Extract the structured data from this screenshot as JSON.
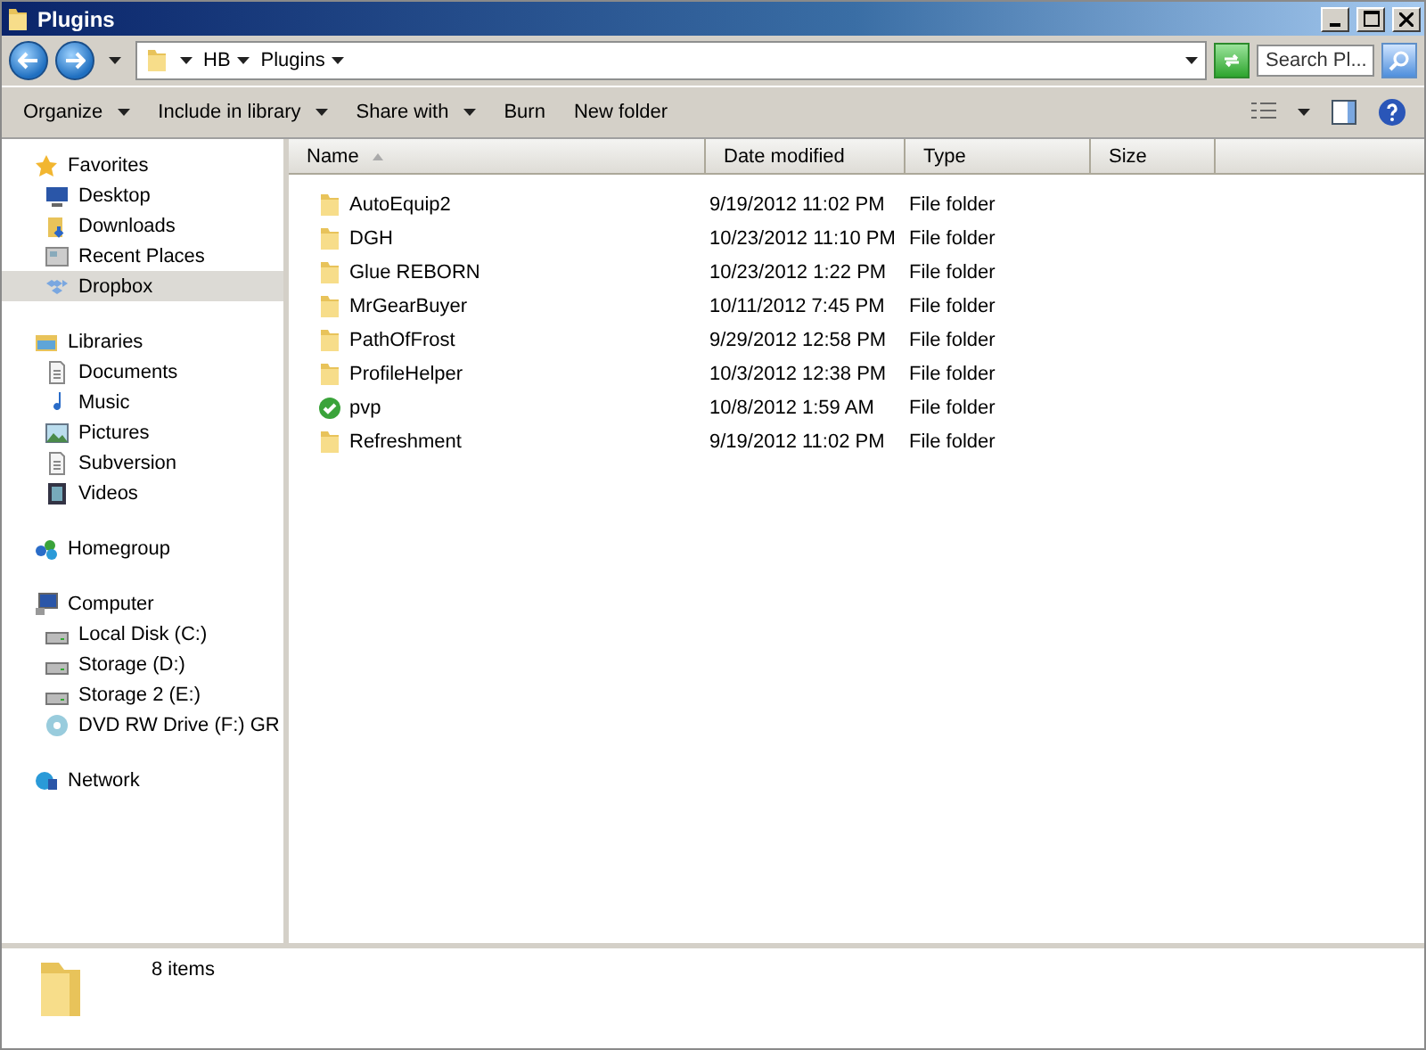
{
  "window": {
    "title": "Plugins"
  },
  "address": {
    "crumbs": [
      "HB",
      "Plugins"
    ],
    "search": {
      "placeholder": "Search Pl..."
    }
  },
  "toolbar": {
    "buttons": [
      {
        "label": "Organize",
        "dropdown": true
      },
      {
        "label": "Include in library",
        "dropdown": true
      },
      {
        "label": "Share with",
        "dropdown": true
      },
      {
        "label": "Burn",
        "dropdown": false
      },
      {
        "label": "New folder",
        "dropdown": false
      }
    ]
  },
  "sidebar": {
    "groups": [
      {
        "label": "Favorites",
        "kind": "star",
        "children": [
          {
            "label": "Desktop",
            "kind": "desktop",
            "selected": false
          },
          {
            "label": "Downloads",
            "kind": "downloads",
            "selected": false
          },
          {
            "label": "Recent Places",
            "kind": "recent",
            "selected": false
          },
          {
            "label": "Dropbox",
            "kind": "dropbox",
            "selected": true
          }
        ]
      },
      {
        "label": "Libraries",
        "kind": "library",
        "children": [
          {
            "label": "Documents",
            "kind": "document",
            "selected": false
          },
          {
            "label": "Music",
            "kind": "music",
            "selected": false
          },
          {
            "label": "Pictures",
            "kind": "pictures",
            "selected": false
          },
          {
            "label": "Subversion",
            "kind": "document",
            "selected": false
          },
          {
            "label": "Videos",
            "kind": "video",
            "selected": false
          }
        ]
      },
      {
        "label": "Homegroup",
        "kind": "homegroup"
      },
      {
        "label": "Computer",
        "kind": "computer",
        "children": [
          {
            "label": "Local Disk (C:)",
            "kind": "disk",
            "selected": false
          },
          {
            "label": "Storage (D:)",
            "kind": "disk",
            "selected": false
          },
          {
            "label": "Storage 2 (E:)",
            "kind": "disk",
            "selected": false
          },
          {
            "label": "DVD RW Drive (F:) GR",
            "kind": "dvd",
            "selected": false
          }
        ]
      },
      {
        "label": "Network",
        "kind": "network"
      }
    ]
  },
  "table": {
    "columns": [
      {
        "label": "Name",
        "sorted": true
      },
      {
        "label": "Date modified",
        "sorted": false
      },
      {
        "label": "Type",
        "sorted": false
      },
      {
        "label": "Size",
        "sorted": false
      }
    ],
    "rows": [
      {
        "name": "AutoEquip2",
        "kind": "folder",
        "date": "9/19/2012 11:02 PM",
        "type": "File folder"
      },
      {
        "name": "DGH",
        "kind": "folder",
        "date": "10/23/2012 11:10 PM",
        "type": "File folder"
      },
      {
        "name": "Glue REBORN",
        "kind": "folder",
        "date": "10/23/2012 1:22 PM",
        "type": "File folder"
      },
      {
        "name": "MrGearBuyer",
        "kind": "folder",
        "date": "10/11/2012 7:45 PM",
        "type": "File folder"
      },
      {
        "name": "PathOfFrost",
        "kind": "folder",
        "date": "9/29/2012 12:58 PM",
        "type": "File folder"
      },
      {
        "name": "ProfileHelper",
        "kind": "folder",
        "date": "10/3/2012 12:38 PM",
        "type": "File folder"
      },
      {
        "name": "pvp",
        "kind": "synced",
        "date": "10/8/2012 1:59 AM",
        "type": "File folder"
      },
      {
        "name": "Refreshment",
        "kind": "folder",
        "date": "9/19/2012 11:02 PM",
        "type": "File folder"
      }
    ]
  },
  "status_bar": {
    "count": "8 items"
  }
}
